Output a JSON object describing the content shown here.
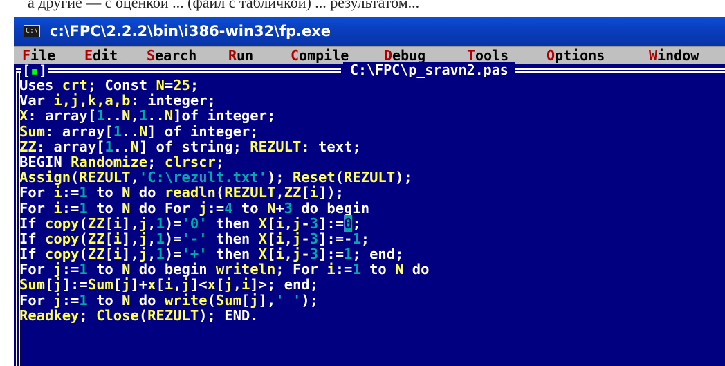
{
  "window": {
    "title": "c:\\FPC\\2.2.2\\bin\\i386-win32\\fp.exe",
    "icon_name": "console-window-icon",
    "icon_glyph": "C:\\"
  },
  "menu": [
    {
      "hot": "F",
      "rest": "ile"
    },
    {
      "hot": "E",
      "rest": "dit"
    },
    {
      "hot": "S",
      "rest": "earch"
    },
    {
      "hot": "R",
      "rest": "un"
    },
    {
      "hot": "C",
      "rest": "ompile"
    },
    {
      "hot": "D",
      "rest": "ebug"
    },
    {
      "hot": "T",
      "rest": "ools"
    },
    {
      "hot": "O",
      "rest": "ptions"
    },
    {
      "hot": "W",
      "rest": "indow"
    }
  ],
  "editor_window": {
    "close_box_left": "[",
    "close_box_mark": "▪",
    "close_box_right": "]",
    "file_title": "C:\\FPC\\p_sravn2.pas"
  },
  "colors": {
    "console_bg": "#000080",
    "text_white": "#ffffff",
    "text_yellow": "#ffff55",
    "text_cyan": "#00aaaa",
    "menu_bg": "#c0c0c0",
    "menu_hotkey": "#aa0000",
    "titlebar": "#0a3fbf"
  },
  "code": [
    [
      [
        "w",
        "Uses "
      ],
      [
        "y",
        "crt"
      ],
      [
        "w",
        "; Const "
      ],
      [
        "y",
        "N"
      ],
      [
        "w",
        "="
      ],
      [
        "y",
        "25"
      ],
      [
        "w",
        ";"
      ]
    ],
    [
      [
        "w",
        "Var "
      ],
      [
        "y",
        "i,j,k,a,b"
      ],
      [
        "w",
        ": integer;"
      ]
    ],
    [
      [
        "y",
        "X"
      ],
      [
        "w",
        ": array["
      ],
      [
        "c",
        "1"
      ],
      [
        "w",
        ".."
      ],
      [
        "y",
        "N"
      ],
      [
        "w",
        ","
      ],
      [
        "c",
        "1"
      ],
      [
        "w",
        ".."
      ],
      [
        "y",
        "N"
      ],
      [
        "w",
        "]of integer;"
      ]
    ],
    [
      [
        "y",
        "Sum"
      ],
      [
        "w",
        ": array["
      ],
      [
        "c",
        "1"
      ],
      [
        "w",
        ".."
      ],
      [
        "y",
        "N"
      ],
      [
        "w",
        "] of integer;"
      ]
    ],
    [
      [
        "y",
        "ZZ"
      ],
      [
        "w",
        ": array["
      ],
      [
        "c",
        "1"
      ],
      [
        "w",
        ".."
      ],
      [
        "y",
        "N"
      ],
      [
        "w",
        "] of string; "
      ],
      [
        "y",
        "REZULT"
      ],
      [
        "w",
        ": text;"
      ]
    ],
    [
      [
        "w",
        "BEGIN "
      ],
      [
        "y",
        "Randomize"
      ],
      [
        "w",
        "; "
      ],
      [
        "y",
        "clrscr"
      ],
      [
        "w",
        ";"
      ]
    ],
    [
      [
        "y",
        "Assign"
      ],
      [
        "w",
        "("
      ],
      [
        "y",
        "REZULT"
      ],
      [
        "w",
        ","
      ],
      [
        "c",
        "'C:\\rezult.txt'"
      ],
      [
        "w",
        "); "
      ],
      [
        "y",
        "Reset"
      ],
      [
        "w",
        "("
      ],
      [
        "y",
        "REZULT"
      ],
      [
        "w",
        ");"
      ]
    ],
    [
      [
        "w",
        "For "
      ],
      [
        "y",
        "i"
      ],
      [
        "w",
        ":="
      ],
      [
        "c",
        "1"
      ],
      [
        "w",
        " to "
      ],
      [
        "y",
        "N"
      ],
      [
        "w",
        " do "
      ],
      [
        "y",
        "readln"
      ],
      [
        "w",
        "("
      ],
      [
        "y",
        "REZULT"
      ],
      [
        "w",
        ","
      ],
      [
        "y",
        "ZZ"
      ],
      [
        "w",
        "["
      ],
      [
        "y",
        "i"
      ],
      [
        "w",
        "]);"
      ]
    ],
    [
      [
        "w",
        "For "
      ],
      [
        "y",
        "i"
      ],
      [
        "w",
        ":="
      ],
      [
        "c",
        "1"
      ],
      [
        "w",
        " to "
      ],
      [
        "y",
        "N"
      ],
      [
        "w",
        " do For "
      ],
      [
        "y",
        "j"
      ],
      [
        "w",
        ":="
      ],
      [
        "c",
        "4"
      ],
      [
        "w",
        " to "
      ],
      [
        "y",
        "N"
      ],
      [
        "w",
        "+"
      ],
      [
        "c",
        "3"
      ],
      [
        "w",
        " do begin"
      ]
    ],
    [
      [
        "w",
        "If "
      ],
      [
        "y",
        "copy"
      ],
      [
        "w",
        "("
      ],
      [
        "y",
        "ZZ"
      ],
      [
        "w",
        "["
      ],
      [
        "y",
        "i"
      ],
      [
        "w",
        "],"
      ],
      [
        "y",
        "j"
      ],
      [
        "w",
        ","
      ],
      [
        "c",
        "1"
      ],
      [
        "w",
        ")="
      ],
      [
        "c",
        "'0'"
      ],
      [
        "w",
        " then "
      ],
      [
        "y",
        "X"
      ],
      [
        "w",
        "["
      ],
      [
        "y",
        "i"
      ],
      [
        "w",
        ","
      ],
      [
        "y",
        "j"
      ],
      [
        "w",
        "-"
      ],
      [
        "c",
        "3"
      ],
      [
        "w",
        "]:="
      ],
      [
        "g",
        "0"
      ],
      [
        "w",
        ";"
      ]
    ],
    [
      [
        "w",
        "If "
      ],
      [
        "y",
        "copy"
      ],
      [
        "w",
        "("
      ],
      [
        "y",
        "ZZ"
      ],
      [
        "w",
        "["
      ],
      [
        "y",
        "i"
      ],
      [
        "w",
        "],"
      ],
      [
        "y",
        "j"
      ],
      [
        "w",
        ","
      ],
      [
        "c",
        "1"
      ],
      [
        "w",
        ")="
      ],
      [
        "c",
        "'-'"
      ],
      [
        "w",
        " then "
      ],
      [
        "y",
        "X"
      ],
      [
        "w",
        "["
      ],
      [
        "y",
        "i"
      ],
      [
        "w",
        ","
      ],
      [
        "y",
        "j"
      ],
      [
        "w",
        "-"
      ],
      [
        "c",
        "3"
      ],
      [
        "w",
        "]:=-"
      ],
      [
        "c",
        "1"
      ],
      [
        "w",
        ";"
      ]
    ],
    [
      [
        "w",
        "If "
      ],
      [
        "y",
        "copy"
      ],
      [
        "w",
        "("
      ],
      [
        "y",
        "ZZ"
      ],
      [
        "w",
        "["
      ],
      [
        "y",
        "i"
      ],
      [
        "w",
        "],"
      ],
      [
        "y",
        "j"
      ],
      [
        "w",
        ","
      ],
      [
        "c",
        "1"
      ],
      [
        "w",
        ")="
      ],
      [
        "c",
        "'+'"
      ],
      [
        "w",
        " then "
      ],
      [
        "y",
        "X"
      ],
      [
        "w",
        "["
      ],
      [
        "y",
        "i"
      ],
      [
        "w",
        ","
      ],
      [
        "y",
        "j"
      ],
      [
        "w",
        "-"
      ],
      [
        "c",
        "3"
      ],
      [
        "w",
        "]:="
      ],
      [
        "c",
        "1"
      ],
      [
        "w",
        "; end;"
      ]
    ],
    [
      [
        "w",
        "For "
      ],
      [
        "y",
        "j"
      ],
      [
        "w",
        ":="
      ],
      [
        "c",
        "1"
      ],
      [
        "w",
        " to "
      ],
      [
        "y",
        "N"
      ],
      [
        "w",
        " do begin "
      ],
      [
        "y",
        "writeln"
      ],
      [
        "w",
        "; For "
      ],
      [
        "y",
        "i"
      ],
      [
        "w",
        ":="
      ],
      [
        "c",
        "1"
      ],
      [
        "w",
        " to "
      ],
      [
        "y",
        "N"
      ],
      [
        "w",
        " do"
      ]
    ],
    [
      [
        "y",
        "Sum"
      ],
      [
        "w",
        "["
      ],
      [
        "y",
        "j"
      ],
      [
        "w",
        "]:="
      ],
      [
        "y",
        "Sum"
      ],
      [
        "w",
        "["
      ],
      [
        "y",
        "j"
      ],
      [
        "w",
        "]+"
      ],
      [
        "y",
        "x"
      ],
      [
        "w",
        "["
      ],
      [
        "y",
        "i"
      ],
      [
        "w",
        ","
      ],
      [
        "y",
        "j"
      ],
      [
        "w",
        "]<"
      ],
      [
        "y",
        "x"
      ],
      [
        "w",
        "["
      ],
      [
        "y",
        "j"
      ],
      [
        "w",
        ","
      ],
      [
        "y",
        "i"
      ],
      [
        "w",
        "]>; end;"
      ]
    ],
    [
      [
        "w",
        "For "
      ],
      [
        "y",
        "j"
      ],
      [
        "w",
        ":="
      ],
      [
        "c",
        "1"
      ],
      [
        "w",
        " to "
      ],
      [
        "y",
        "N"
      ],
      [
        "w",
        " do "
      ],
      [
        "y",
        "write"
      ],
      [
        "w",
        "("
      ],
      [
        "y",
        "Sum"
      ],
      [
        "w",
        "["
      ],
      [
        "y",
        "j"
      ],
      [
        "w",
        "],"
      ],
      [
        "c",
        "' '"
      ],
      [
        "w",
        ");"
      ]
    ],
    [
      [
        "y",
        "Readkey"
      ],
      [
        "w",
        "; "
      ],
      [
        "y",
        "Close"
      ],
      [
        "w",
        "("
      ],
      [
        "y",
        "REZULT"
      ],
      [
        "w",
        "); END."
      ]
    ]
  ],
  "top_strip_text": "а другие — с оценкой ... (файл с табличкой) ... результатом..."
}
